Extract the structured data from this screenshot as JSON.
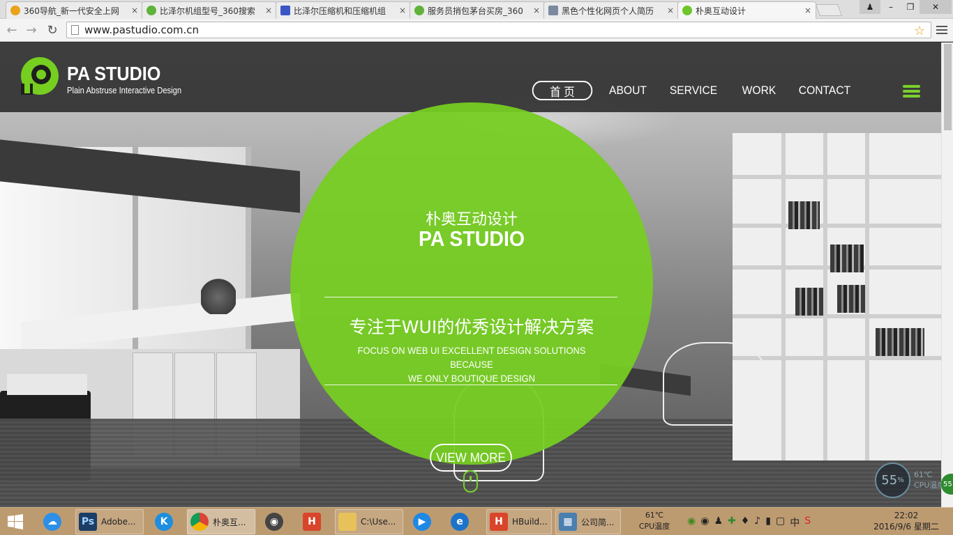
{
  "browser": {
    "tabs": [
      {
        "title": "360导航_新一代安全上网",
        "favicon_color": "#e9a21a"
      },
      {
        "title": "比泽尔机组型号_360搜索",
        "favicon_color": "#5fb33b"
      },
      {
        "title": "比泽尔压缩机和压缩机组",
        "favicon_color": "#3a56c6"
      },
      {
        "title": "服务员捎包茅台买房_360",
        "favicon_color": "#5fb33b"
      },
      {
        "title": "黑色个性化网页个人简历",
        "favicon_color": "#7b8aa0"
      },
      {
        "title": "朴奥互动设计",
        "favicon_color": "#6cc62a"
      }
    ],
    "close_glyph": "×",
    "url": "www.pastudio.com.cn",
    "window_controls": {
      "minimize": "–",
      "maximize": "❐",
      "close": "✕"
    }
  },
  "site": {
    "brand": {
      "name": "PA STUDIO",
      "tagline": "Plain Abstruse Interactive Design",
      "accent_color": "#76ce21"
    },
    "nav": [
      {
        "label": "首 页",
        "active": true
      },
      {
        "label": "ABOUT",
        "active": false
      },
      {
        "label": "SERVICE",
        "active": false
      },
      {
        "label": "WORK",
        "active": false
      },
      {
        "label": "CONTACT",
        "active": false
      }
    ],
    "hero": {
      "cn_title": "朴奥互动设计",
      "en_title": "PA STUDIO",
      "slogan": "专注于WUI的优秀设计解决方案",
      "subtitle_line1": "FOCUS ON WEB UI EXCELLENT DESIGN SOLUTIONS BECAUSE",
      "subtitle_line2": "WE ONLY BOUTIQUE DESIGN",
      "cta": "VIEW MORE"
    }
  },
  "widget": {
    "percent": "55",
    "percent_sign": "%",
    "temp": "61℃",
    "label": "CPU温度",
    "edge": "55"
  },
  "taskbar": {
    "items": [
      {
        "label": "Adobe...",
        "icon": "Ps",
        "color": "#1b3d66"
      },
      {
        "label": "朴奥互...",
        "icon": "chrome",
        "color": "#db4437"
      },
      {
        "label": "C:\\Use...",
        "icon": "folder",
        "color": "#e7c25a"
      },
      {
        "label": "HBuild...",
        "icon": "H",
        "color": "#d9452b"
      },
      {
        "label": "公司简...",
        "icon": "doc",
        "color": "#4a7fb0"
      }
    ],
    "tray": {
      "temp": "61℃",
      "temp_label": "CPU温度",
      "ime": "中",
      "time": "22:02",
      "date": "2016/9/6 星期二"
    }
  }
}
